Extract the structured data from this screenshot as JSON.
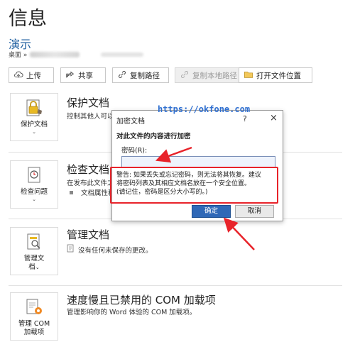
{
  "header": {
    "page_title": "信息",
    "doc_name": "演示",
    "path_prefix": "桌面 »"
  },
  "toolbar": {
    "upload": "上传",
    "share": "共享",
    "copy_path": "复制路径",
    "copy_local_path": "复制本地路径",
    "open_location": "打开文件位置"
  },
  "sections": {
    "protect": {
      "tile_label": "保护文档",
      "title": "保护文档",
      "desc": "控制其他人可以"
    },
    "inspect": {
      "tile_label": "检查问题",
      "title": "检查文档",
      "desc": "在发布此文件之",
      "sub": "文档属性和"
    },
    "manage": {
      "tile_label_1": "管理文",
      "tile_label_2": "档",
      "title": "管理文档",
      "desc": "没有任何未保存的更改。"
    },
    "com": {
      "tile_label_1": "管理 COM",
      "tile_label_2": "加载项",
      "title": "速度慢且已禁用的 COM 加载项",
      "desc": "管理影响你的 Word 体验的 COM 加载项。"
    }
  },
  "dialog": {
    "title": "加密文档",
    "help": "?",
    "close": "×",
    "heading": "对此文件的内容进行加密",
    "password_label": "密码(R):",
    "password_value": "",
    "warning_1": "警告: 如果丢失或忘记密码，则无法将其恢复。建议",
    "warning_2": "将密码列表及其相应文档名放在一个安全位置。",
    "warning_3": "(请记住，密码是区分大小写的。)",
    "ok": "确定",
    "cancel": "取消"
  },
  "watermark": "https://okfone.com",
  "colors": {
    "accent": "#2f68b7",
    "annotation": "#e8232a",
    "title_blue": "#1f5fa0"
  }
}
